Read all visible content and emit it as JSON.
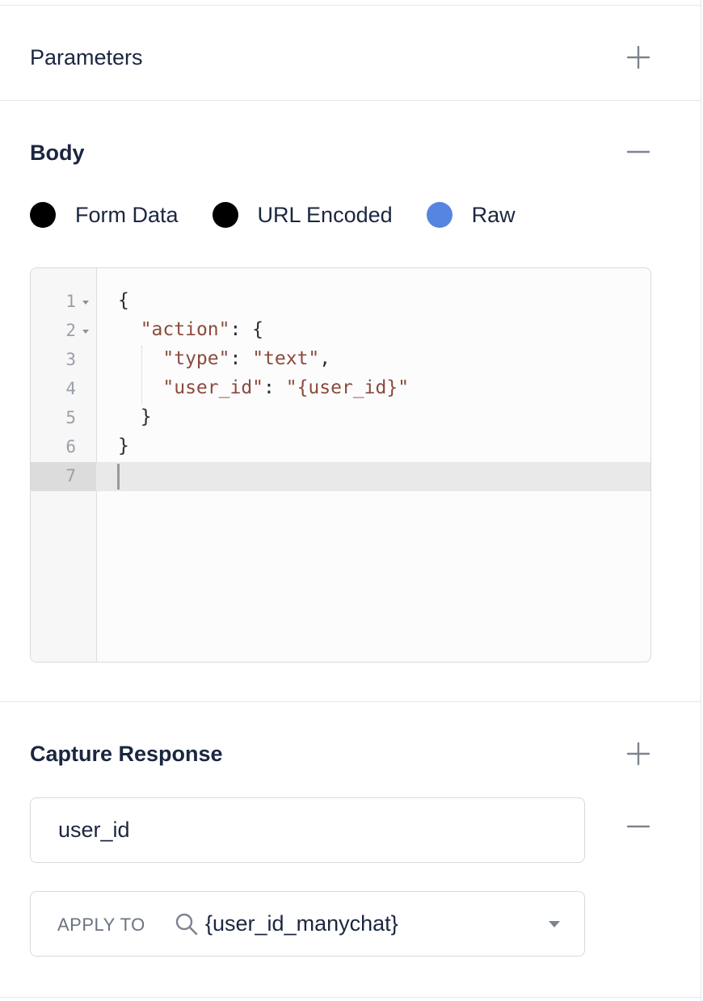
{
  "parameters": {
    "title": "Parameters"
  },
  "body": {
    "title": "Body",
    "radios": [
      {
        "label": "Form Data",
        "selected": false
      },
      {
        "label": "URL Encoded",
        "selected": false
      },
      {
        "label": "Raw",
        "selected": true
      }
    ],
    "editor": {
      "line_numbers": [
        "1",
        "2",
        "3",
        "4",
        "5",
        "6",
        "7"
      ],
      "active_line": 7
    }
  },
  "capture_response": {
    "title": "Capture Response",
    "field_value": "user_id",
    "apply_to": {
      "label": "APPLY TO",
      "value": "{user_id_manychat}"
    }
  },
  "colors": {
    "accent": "#5585e0",
    "string": "#8c4a3c",
    "text": "#1b2640"
  }
}
